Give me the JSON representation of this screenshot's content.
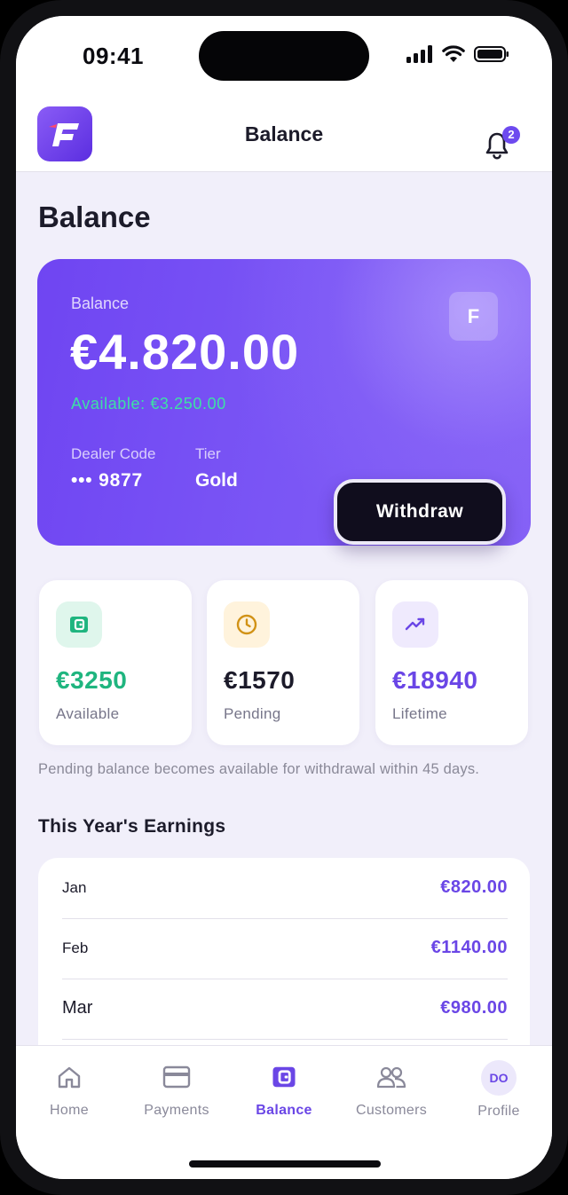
{
  "status_bar": {
    "time": "09:41"
  },
  "header": {
    "logo_letter": "F",
    "title": "Balance",
    "notification_count": "2"
  },
  "page": {
    "title": "Balance"
  },
  "balance_card": {
    "label": "Balance",
    "amount": "€4.820.00",
    "available": "Available: €3.250.00",
    "brand_letter": "F",
    "dealer_code_label": "Dealer Code",
    "dealer_code_value": "••• 9877",
    "tier_label": "Tier",
    "tier_value": "Gold",
    "withdraw_label": "Withdraw"
  },
  "stats": [
    {
      "value": "€3250",
      "label": "Available",
      "icon": "wallet-icon",
      "color": "#1fb57f"
    },
    {
      "value": "€1570",
      "label": "Pending",
      "icon": "clock-icon",
      "color": "#1c1b2a"
    },
    {
      "value": "€18940",
      "label": "Lifetime",
      "icon": "trending-up-icon",
      "color": "#6a46e6"
    }
  ],
  "note": "Pending balance becomes available for withdrawal within 45 days.",
  "earnings": {
    "title": "This Year's Earnings",
    "rows": [
      {
        "month": "Jan",
        "amount": "€820.00"
      },
      {
        "month": "Feb",
        "amount": "€1140.00"
      },
      {
        "month": "Mar",
        "amount": "€980.00"
      }
    ]
  },
  "tabbar": {
    "items": [
      {
        "label": "Home",
        "icon": "home-icon"
      },
      {
        "label": "Payments",
        "icon": "credit-card-icon"
      },
      {
        "label": "Balance",
        "icon": "wallet-icon",
        "active": true
      },
      {
        "label": "Customers",
        "icon": "users-icon"
      },
      {
        "label": "Profile",
        "icon": "avatar",
        "avatar_initials": "DO"
      }
    ]
  },
  "colors": {
    "accent": "#6a46e6",
    "positive": "#1fb57f",
    "card_gradient_start": "#6f45f2",
    "card_gradient_end": "#8460f6"
  }
}
